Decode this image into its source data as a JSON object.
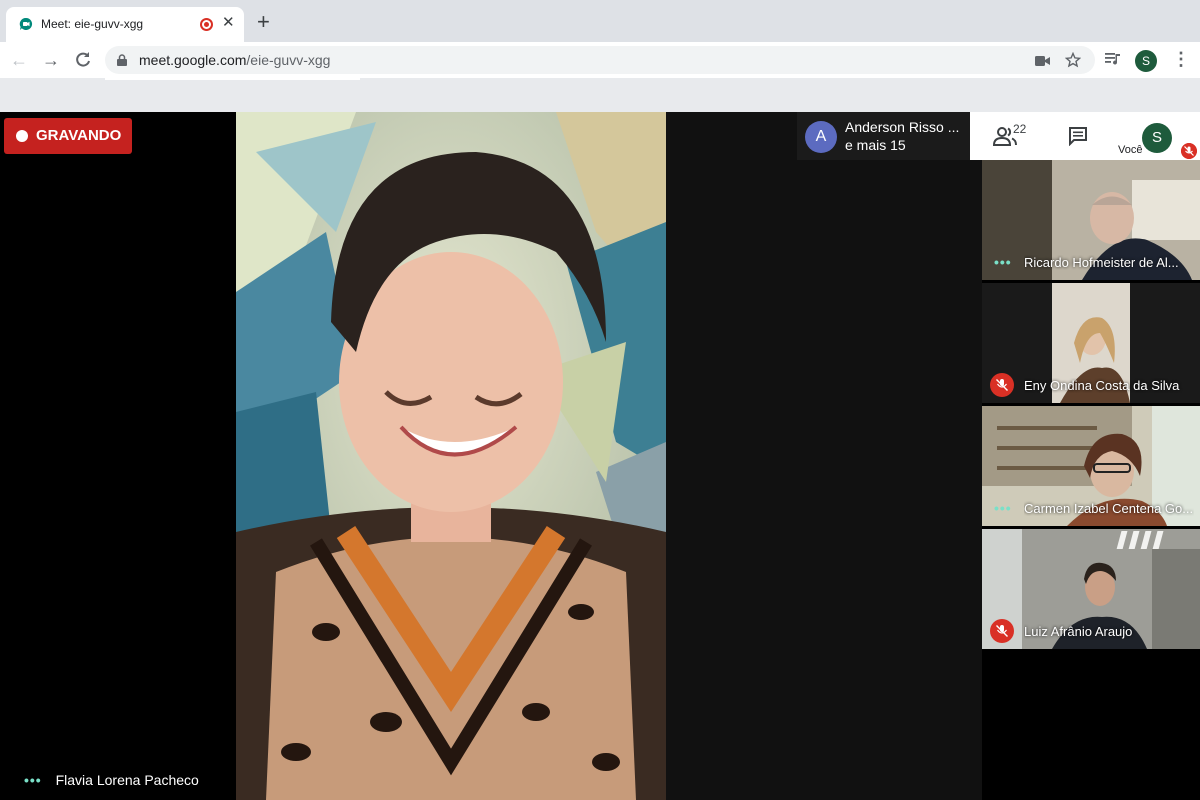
{
  "browser": {
    "tab_title": "Meet: eie-guvv-xgg",
    "url_host": "meet.google.com",
    "url_path": "/eie-guvv-xgg",
    "profile_initial": "S"
  },
  "meeting": {
    "recording_label": "GRAVANDO",
    "main_speaker": "Flavia Lorena Pacheco",
    "participants_popup": {
      "avatar_initial": "A",
      "name": "Anderson Risso ...",
      "more": "e mais 15"
    },
    "people_count": "22",
    "you_initial": "S",
    "you_label": "Você",
    "tiles": [
      {
        "name": "Ricardo Hofmeister de Al...",
        "status": "speaking-dots"
      },
      {
        "name": "Eny Ondina Costa da Silva",
        "status": "muted"
      },
      {
        "name": "Carmen Izabel Centena Go...",
        "status": "speaking-dots"
      },
      {
        "name": "Luiz Afrânio Araujo",
        "status": "muted"
      }
    ]
  },
  "colors": {
    "recording_red": "#c5221f",
    "mute_red": "#d93025",
    "accent_teal": "#7ae0c8",
    "avatar_indigo": "#5c6bc0",
    "avatar_green": "#1e5b3c"
  }
}
